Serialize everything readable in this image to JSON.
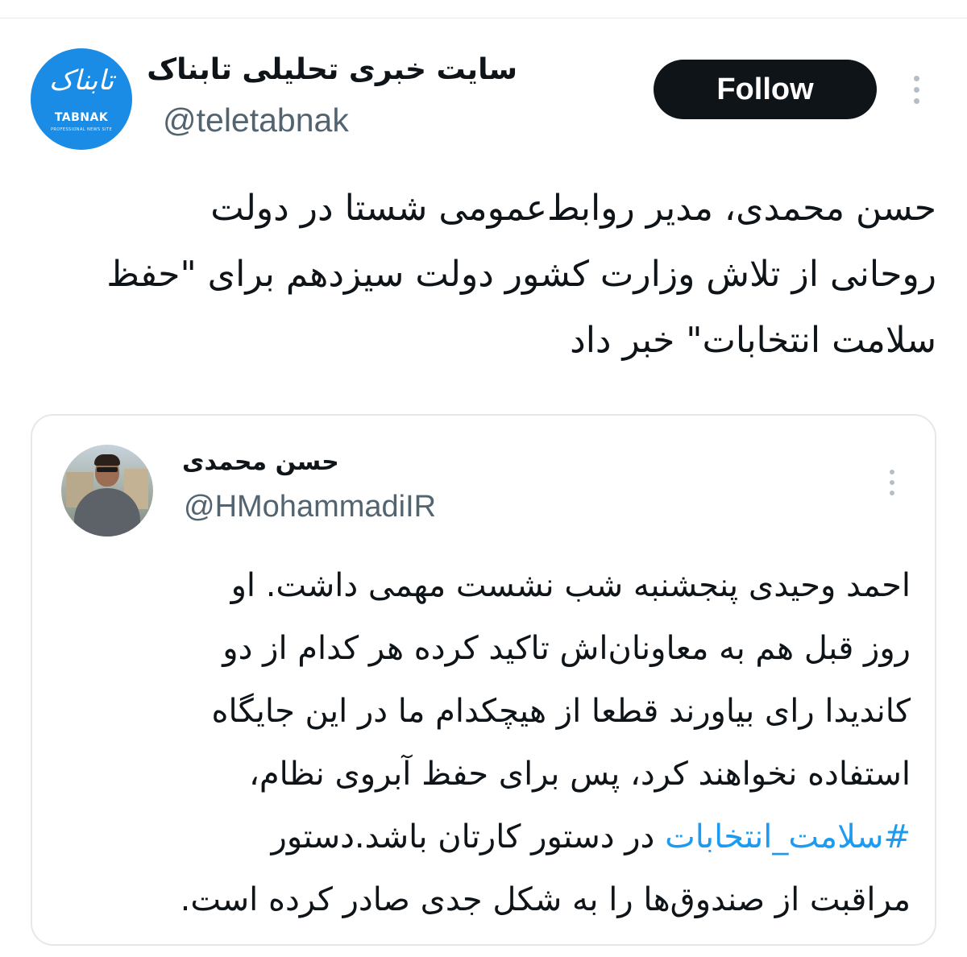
{
  "tweet": {
    "author": {
      "display_name": "سایت خبری تحلیلی تابناک",
      "handle": "@teletabnak",
      "avatar_logo_script": "تابناک",
      "avatar_logo_word": "TABNAK",
      "avatar_logo_tagline": "PROFESSIONAL NEWS SITE"
    },
    "follow_label": "Follow",
    "text_lines": [
      "حسن محمدی، مدیر روابط‌عمومی شستا در دولت",
      "روحانی از تلاش وزارت کشور دولت سیزدهم برای \"حفظ",
      "سلامت انتخابات\" خبر داد"
    ]
  },
  "quoted_tweet": {
    "author": {
      "display_name": "حسن محمدی",
      "handle": "@HMohammadiIR"
    },
    "lines": [
      {
        "text": "احمد وحیدی پنجشنبه شب نشست مهمی داشت. او"
      },
      {
        "text": "روز قبل هم به معاونان‌اش تاکید کرده هر کدام از دو"
      },
      {
        "text": "کاندیدا رای بیاورند قطعا از هیچکدام ما در این جایگاه"
      },
      {
        "text": "استفاده نخواهند کرد، پس برای حفظ آبروی نظام،"
      },
      {
        "hashtag": "#سلامت_انتخابات",
        "text": " در دستور کارتان باشد.دستور"
      },
      {
        "text": "مراقبت از صندوق‌ها را به شکل جدی صادر کرده است."
      }
    ]
  },
  "icons": {
    "more_options": "kebab-vertical-icon"
  },
  "colors": {
    "follow_bg": "#0f1419",
    "handle_gray": "#536471",
    "hashtag_blue": "#1d9bf0",
    "avatar_blue": "#1a8ce5"
  }
}
